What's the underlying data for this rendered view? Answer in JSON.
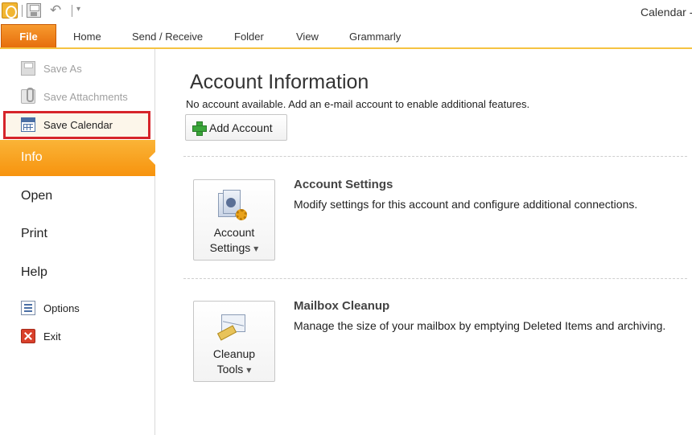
{
  "window": {
    "title": "Calendar -"
  },
  "quick_access": {
    "icons": [
      "outlook-app-icon",
      "save-icon",
      "undo-icon",
      "customize-toolbar-icon"
    ]
  },
  "ribbon": {
    "file_tab": "File",
    "tabs": [
      "Home",
      "Send / Receive",
      "Folder",
      "View",
      "Grammarly"
    ]
  },
  "nav": {
    "save_as": "Save As",
    "save_attachments": "Save Attachments",
    "save_calendar": "Save Calendar",
    "info": "Info",
    "open": "Open",
    "print": "Print",
    "help": "Help",
    "options": "Options",
    "exit": "Exit",
    "highlight_color": "#d6242a"
  },
  "main": {
    "title": "Account Information",
    "subtitle": "No account available. Add an e-mail account to enable additional features.",
    "add_account_label": "Add Account",
    "account_settings": {
      "button_line1": "Account",
      "button_line2": "Settings",
      "title": "Account Settings",
      "description": "Modify settings for this account and configure additional connections."
    },
    "mailbox_cleanup": {
      "button_line1": "Cleanup",
      "button_line2": "Tools",
      "title": "Mailbox Cleanup",
      "description": "Manage the size of your mailbox by emptying Deleted Items and archiving."
    }
  },
  "colors": {
    "file_tab": "#e56b0a",
    "info_highlight": "#f7930e",
    "ribbon_accent": "#f5c342"
  }
}
